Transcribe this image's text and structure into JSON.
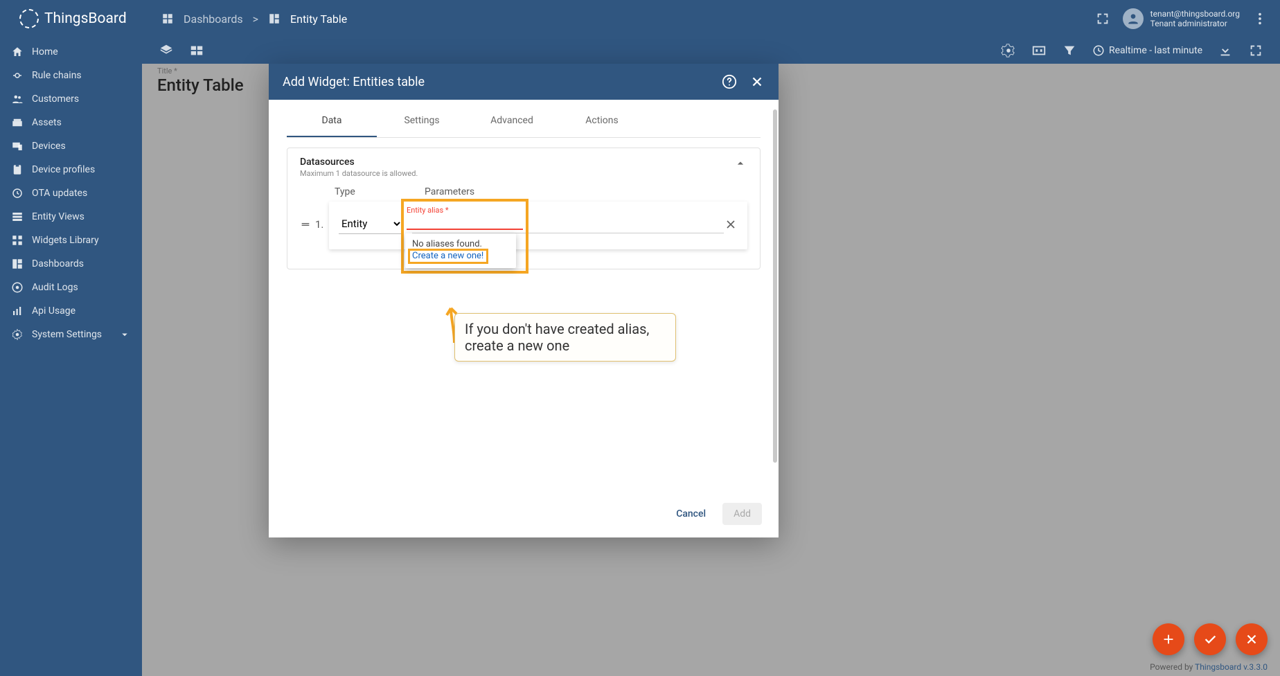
{
  "app": {
    "name": "ThingsBoard"
  },
  "breadcrumb": {
    "dashboards": "Dashboards",
    "sep": ">",
    "current": "Entity Table"
  },
  "user": {
    "email": "tenant@thingsboard.org",
    "role": "Tenant administrator"
  },
  "sidebar": {
    "items": [
      {
        "label": "Home",
        "icon": "home"
      },
      {
        "label": "Rule chains",
        "icon": "rules"
      },
      {
        "label": "Customers",
        "icon": "customers"
      },
      {
        "label": "Assets",
        "icon": "assets"
      },
      {
        "label": "Devices",
        "icon": "devices"
      },
      {
        "label": "Device profiles",
        "icon": "profiles"
      },
      {
        "label": "OTA updates",
        "icon": "ota"
      },
      {
        "label": "Entity Views",
        "icon": "views"
      },
      {
        "label": "Widgets Library",
        "icon": "widgets"
      },
      {
        "label": "Dashboards",
        "icon": "dash"
      },
      {
        "label": "Audit Logs",
        "icon": "audit"
      },
      {
        "label": "Api Usage",
        "icon": "api"
      },
      {
        "label": "System Settings",
        "icon": "settings",
        "expandable": true
      }
    ]
  },
  "subtoolbar": {
    "realtime": "Realtime - last minute"
  },
  "page": {
    "title_label": "Title *",
    "title": "Entity Table"
  },
  "modal": {
    "title": "Add Widget: Entities table",
    "tabs": {
      "data": "Data",
      "settings": "Settings",
      "advanced": "Advanced",
      "actions": "Actions"
    },
    "panel": {
      "title": "Datasources",
      "sub": "Maximum 1 datasource is allowed."
    },
    "cols": {
      "type": "Type",
      "params": "Parameters"
    },
    "row": {
      "num": "1.",
      "type": "Entity"
    },
    "alias": {
      "label": "Entity alias *",
      "none": "No aliases found.",
      "create": "Create a new one!"
    },
    "callout": "If you don't have created alias, create a new one",
    "cancel": "Cancel",
    "add": "Add"
  },
  "footer": {
    "pre": "Powered by ",
    "link": "Thingsboard v.3.3.0"
  }
}
